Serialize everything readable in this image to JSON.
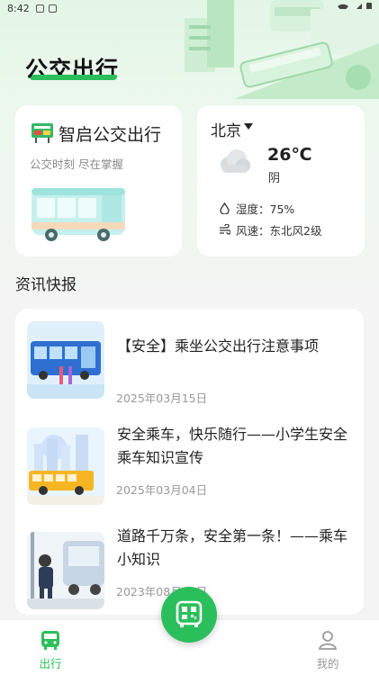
{
  "status_bar": {
    "time": "8:42"
  },
  "app": {
    "title": "公交出行"
  },
  "bus_card": {
    "name": "智启公交出行",
    "subtitle": "公交时刻 尽在掌握"
  },
  "weather": {
    "city": "北京",
    "temperature": "26℃",
    "condition": "阴",
    "humidity": "湿度：75%",
    "wind": "风速：东北风2级"
  },
  "news": {
    "section_title": "资讯快报",
    "items": [
      {
        "title": "【安全】乘坐公交出行注意事项",
        "date": "2025年03月15日"
      },
      {
        "title": "安全乘车，快乐随行——小学生安全乘车知识宣传",
        "date": "2025年03月04日"
      },
      {
        "title": "道路千万条，安全第一条！——乘车小知识",
        "date": "2023年08月31日"
      }
    ]
  },
  "tabs": {
    "travel": {
      "label": "出行",
      "color": "#2bbf5b"
    },
    "mine": {
      "label": "我的",
      "color": "#999999"
    }
  },
  "colors": {
    "accent": "#2bbf5b",
    "background": "#f3f4f3"
  }
}
